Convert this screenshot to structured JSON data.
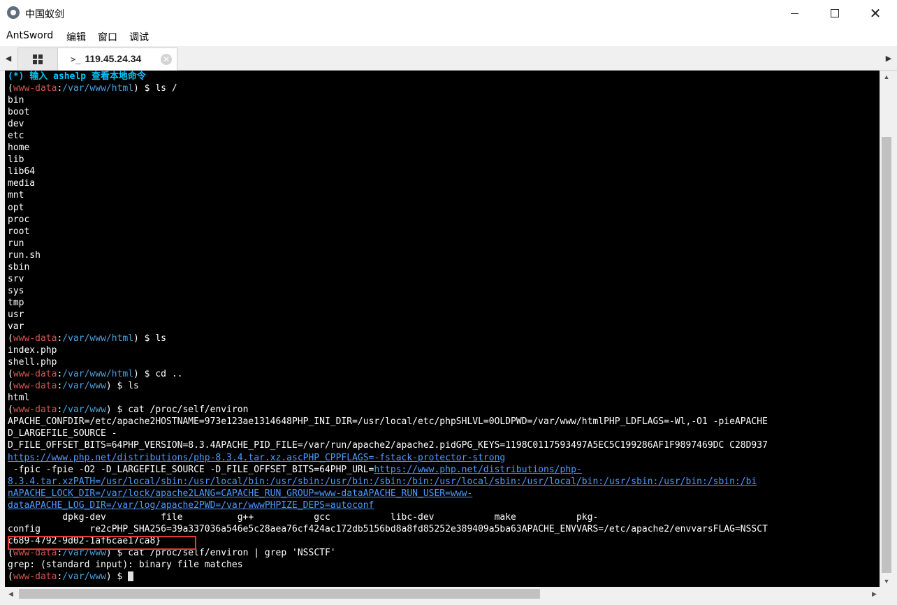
{
  "window": {
    "title": "中国蚁剑",
    "minimize_glyph": "",
    "maximize_glyph": "",
    "close_glyph": "✕"
  },
  "menu": {
    "items": [
      "AntSword",
      "编辑",
      "窗口",
      "调试"
    ]
  },
  "tabs": {
    "left_arrow": "◀",
    "right_arrow": "▶",
    "active_prompt": ">_",
    "active_label": "119.45.24.34",
    "close_glyph": "✕"
  },
  "prompt": {
    "user": "www-data"
  },
  "terminal": {
    "hint": "(*) 输入 ashelp 查看本地命令",
    "lines": [
      {
        "t": "p",
        "path": "/var/www/html",
        "cmd": "ls /"
      },
      {
        "t": "o",
        "s": "bin"
      },
      {
        "t": "o",
        "s": "boot"
      },
      {
        "t": "o",
        "s": "dev"
      },
      {
        "t": "o",
        "s": "etc"
      },
      {
        "t": "o",
        "s": "home"
      },
      {
        "t": "o",
        "s": "lib"
      },
      {
        "t": "o",
        "s": "lib64"
      },
      {
        "t": "o",
        "s": "media"
      },
      {
        "t": "o",
        "s": "mnt"
      },
      {
        "t": "o",
        "s": "opt"
      },
      {
        "t": "o",
        "s": "proc"
      },
      {
        "t": "o",
        "s": "root"
      },
      {
        "t": "o",
        "s": "run"
      },
      {
        "t": "o",
        "s": "run.sh"
      },
      {
        "t": "o",
        "s": "sbin"
      },
      {
        "t": "o",
        "s": "srv"
      },
      {
        "t": "o",
        "s": "sys"
      },
      {
        "t": "o",
        "s": "tmp"
      },
      {
        "t": "o",
        "s": "usr"
      },
      {
        "t": "o",
        "s": "var"
      },
      {
        "t": "p",
        "path": "/var/www/html",
        "cmd": "ls"
      },
      {
        "t": "o",
        "s": "index.php"
      },
      {
        "t": "o",
        "s": "shell.php"
      },
      {
        "t": "p",
        "path": "/var/www/html",
        "cmd": "cd .."
      },
      {
        "t": "p",
        "path": "/var/www",
        "cmd": "ls"
      },
      {
        "t": "o",
        "s": "html"
      },
      {
        "t": "p",
        "path": "/var/www",
        "cmd": "cat /proc/self/environ"
      },
      {
        "t": "o",
        "s": "APACHE_CONFDIR=/etc/apache2HOSTNAME=973e123ae1314648PHP_INI_DIR=/usr/local/etc/phpSHLVL=0OLDPWD=/var/www/htmlPHP_LDFLAGS=-Wl,-O1 -pieAPACHE"
      },
      {
        "t": "o",
        "s": "D_LARGEFILE_SOURCE -"
      },
      {
        "t": "o",
        "s": "D_FILE_OFFSET_BITS=64PHP_VERSION=8.3.4APACHE_PID_FILE=/var/run/apache2/apache2.pidGPG_KEYS=1198C0117593497A5EC5C199286AF1F9897469DC C28D937"
      },
      {
        "t": "l",
        "s": "https://www.php.net/distributions/php-8.3.4.tar.xz.ascPHP_CPPFLAGS=-fstack-protector-strong"
      },
      {
        "t": "m",
        "pre": " -fpic -fpie -O2 -D_LARGEFILE_SOURCE -D_FILE_OFFSET_BITS=64PHP_URL=",
        "link": "https://www.php.net/distributions/php-"
      },
      {
        "t": "l",
        "s": "8.3.4.tar.xzPATH=/usr/local/sbin:/usr/local/bin:/usr/sbin:/usr/bin:/sbin:/bin:/usr/local/sbin:/usr/local/bin:/usr/sbin:/usr/bin:/sbin:/bi"
      },
      {
        "t": "l",
        "s": "nAPACHE_LOCK_DIR=/var/lock/apache2LANG=CAPACHE_RUN_GROUP=www-dataAPACHE_RUN_USER=www-"
      },
      {
        "t": "l",
        "s": "dataAPACHE_LOG_DIR=/var/log/apache2PWD=/var/wwwPHPIZE_DEPS=autoconf"
      },
      {
        "t": "o",
        "s": "          dpkg-dev          file          g++           gcc           libc-dev           make           pkg-"
      },
      {
        "t": "o",
        "s": "config         re2cPHP_SHA256=39a337036a546e5c28aea76cf424ac172db5156bd8a8fd85252e389409a5ba63APACHE_ENVVARS=/etc/apache2/envvarsFLAG=NSSCT"
      },
      {
        "t": "o",
        "s": "c689-4792-9d02-1af6cae17ca8}"
      },
      {
        "t": "p",
        "path": "/var/www",
        "cmd": "cat /proc/self/environ | grep 'NSSCTF'"
      },
      {
        "t": "o",
        "s": "grep: (standard input): binary file matches"
      },
      {
        "t": "c",
        "path": "/var/www"
      }
    ]
  },
  "scroll": {
    "up": "▲",
    "down": "▼",
    "left": "◀",
    "right": "▶"
  }
}
